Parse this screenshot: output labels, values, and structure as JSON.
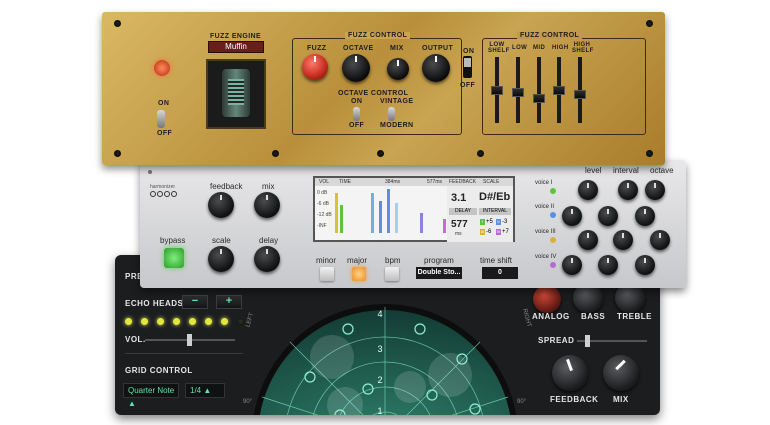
{
  "fuzz": {
    "engine_title": "FUZZ ENGINE",
    "engine_value": "Muffin",
    "control_title": "FUZZ CONTROL",
    "knobs": [
      "FUZZ",
      "OCTAVE",
      "MIX",
      "OUTPUT"
    ],
    "octave_title": "OCTAVE CONTROL",
    "switch_on": "ON",
    "switch_off": "OFF",
    "vintage": "VINTAGE",
    "modern": "MODERN",
    "power_on": "ON",
    "power_off": "OFF",
    "eq_title": "FUZZ CONTROL",
    "eq_bands": [
      "LOW SHELF",
      "LOW",
      "MID",
      "HIGH",
      "HIGH SHELF"
    ],
    "eq_levels": [
      0.5,
      0.45,
      0.35,
      0.5,
      0.42
    ],
    "accent": "#d8302a"
  },
  "harmonizer": {
    "brand": "harmonizer",
    "feedback": "feedback",
    "mix": "mix",
    "scale": "scale",
    "delay": "delay",
    "bypass": "bypass",
    "screen": {
      "vol": "VOL",
      "time": "TIME",
      "t1": "384ms",
      "t2": "577ms",
      "feedback_hdr": "FEEDBACK",
      "scale_hdr": "SCALE",
      "db_labels": [
        "0 dB",
        "-6 dB",
        "-12 dB",
        "-INF"
      ],
      "feedback_val": "3.1",
      "scale_val": "D#/Eb",
      "delay_hdr": "DELAY",
      "interval_hdr": "INTERVAL",
      "delay_val": "577",
      "delay_unit": "ms",
      "intervals": [
        {
          "tag": "I",
          "val": "+5",
          "color": "#5ec43a"
        },
        {
          "tag": "II",
          "val": "-3",
          "color": "#5c8fe0"
        },
        {
          "tag": "III",
          "val": "-6",
          "color": "#d7b13a"
        },
        {
          "tag": "IV",
          "val": "+7",
          "color": "#b86bd6"
        }
      ]
    },
    "modes": [
      "minor",
      "major",
      "bpm"
    ],
    "program_label": "program",
    "program_value": "Double Sto...",
    "timeshift_label": "time shift",
    "timeshift_value": "0",
    "col_headers": [
      "level",
      "interval",
      "octave"
    ],
    "voices": [
      {
        "name": "voice I",
        "color": "#5ec43a"
      },
      {
        "name": "voice II",
        "color": "#5c8fe0"
      },
      {
        "name": "voice III",
        "color": "#d7b13a"
      },
      {
        "name": "voice IV",
        "color": "#b86bd6"
      }
    ]
  },
  "echo": {
    "preset": "PRES",
    "echo_heads": "ECHO HEADS",
    "minus": "−",
    "plus": "+",
    "vol": "VOL.",
    "grid_control": "GRID CONTROL",
    "grid_note": "Quarter Note",
    "grid_div": "1/4",
    "radar_numbers": [
      "4",
      "3",
      "2",
      "1"
    ],
    "left": "LEFT",
    "right": "RIGHT",
    "deg_left": "90°",
    "deg_right": "90°",
    "analog": "ANALOG",
    "bass": "BASS",
    "treble": "TREBLE",
    "spread": "SPREAD",
    "feedback": "FEEDBACK",
    "mix": "MIX"
  }
}
